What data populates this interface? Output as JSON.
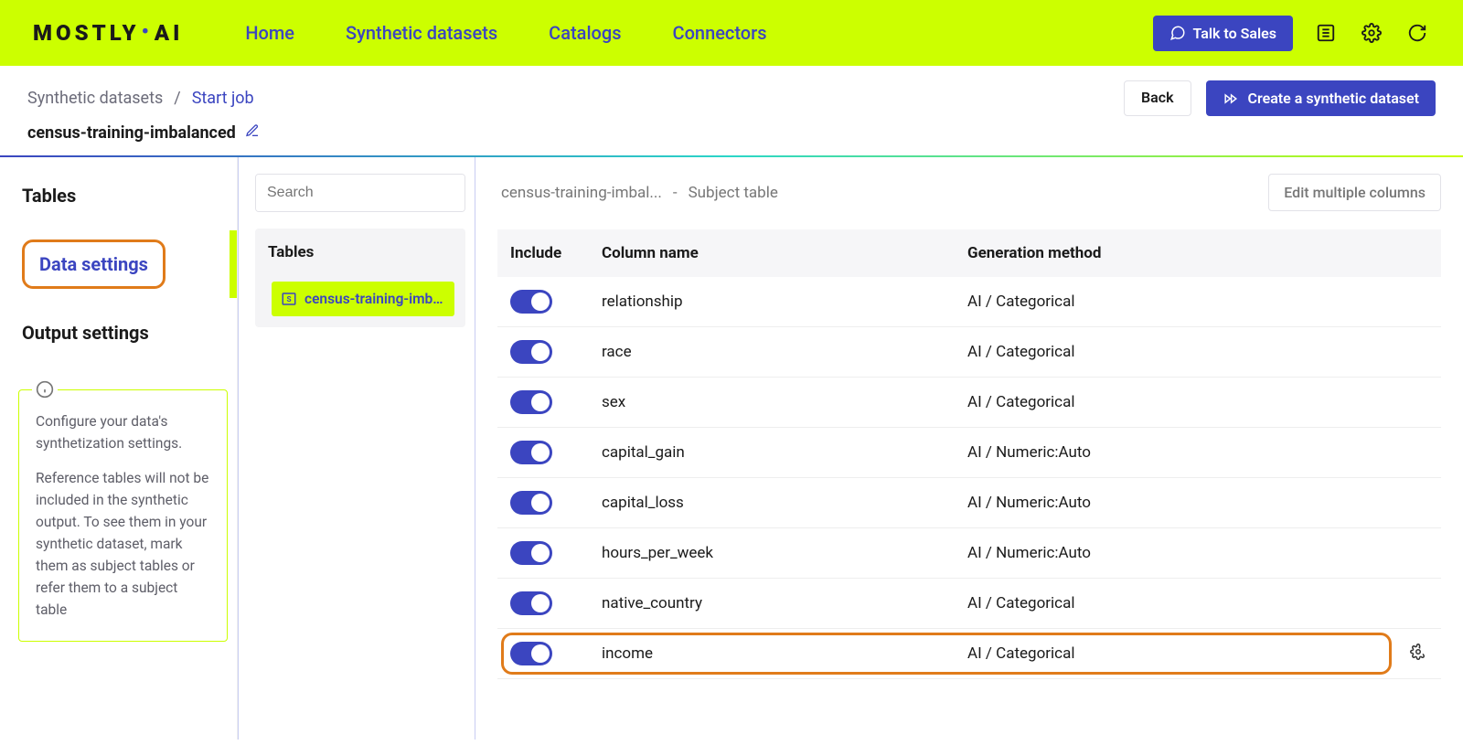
{
  "brand": "MOSTLY·AI",
  "nav": {
    "items": [
      "Home",
      "Synthetic datasets",
      "Catalogs",
      "Connectors"
    ]
  },
  "topbar": {
    "talk_to_sales": "Talk to Sales"
  },
  "breadcrumb": {
    "root": "Synthetic datasets",
    "current": "Start job"
  },
  "header_actions": {
    "back": "Back",
    "create": "Create a synthetic dataset"
  },
  "dataset": {
    "name": "census-training-imbalanced"
  },
  "left_nav": {
    "tables": "Tables",
    "data_settings": "Data settings",
    "output_settings": "Output settings"
  },
  "info": {
    "p1": "Configure your data's synthetization settings.",
    "p2": "Reference tables will not be included in the synthetic output. To see them in your synthetic dataset, mark them as subject tables or refer them to a subject table"
  },
  "tables_panel": {
    "search_placeholder": "Search",
    "header": "Tables",
    "items": [
      "census-training-imbal..."
    ]
  },
  "columns_panel": {
    "table_label": "census-training-imbal...",
    "separator": "-",
    "subtitle": "Subject table",
    "edit_multiple": "Edit multiple columns",
    "headers": {
      "include": "Include",
      "name": "Column name",
      "method": "Generation method"
    },
    "rows": [
      {
        "name": "relationship",
        "method": "AI / Categorical",
        "included": true,
        "highlight": false,
        "gear": false
      },
      {
        "name": "race",
        "method": "AI / Categorical",
        "included": true,
        "highlight": false,
        "gear": false
      },
      {
        "name": "sex",
        "method": "AI / Categorical",
        "included": true,
        "highlight": false,
        "gear": false
      },
      {
        "name": "capital_gain",
        "method": "AI / Numeric:Auto",
        "included": true,
        "highlight": false,
        "gear": false
      },
      {
        "name": "capital_loss",
        "method": "AI / Numeric:Auto",
        "included": true,
        "highlight": false,
        "gear": false
      },
      {
        "name": "hours_per_week",
        "method": "AI / Numeric:Auto",
        "included": true,
        "highlight": false,
        "gear": false
      },
      {
        "name": "native_country",
        "method": "AI / Categorical",
        "included": true,
        "highlight": false,
        "gear": false
      },
      {
        "name": "income",
        "method": "AI / Categorical",
        "included": true,
        "highlight": true,
        "gear": true
      }
    ]
  }
}
